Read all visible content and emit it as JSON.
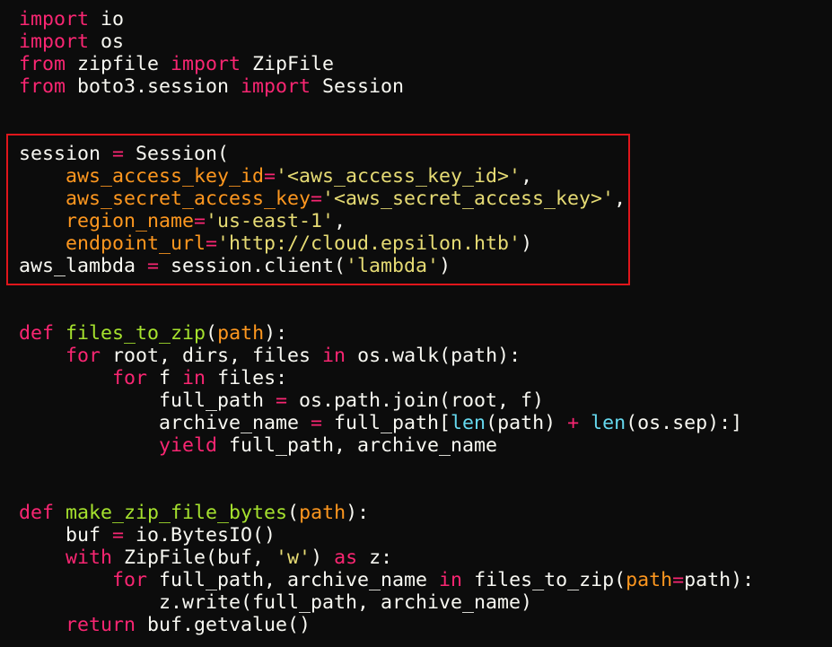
{
  "code_lines": [
    [
      {
        "t": "import",
        "c": "kw"
      },
      {
        "t": " io",
        "c": ""
      }
    ],
    [
      {
        "t": "import",
        "c": "kw"
      },
      {
        "t": " os",
        "c": ""
      }
    ],
    [
      {
        "t": "from",
        "c": "kw"
      },
      {
        "t": " zipfile ",
        "c": ""
      },
      {
        "t": "import",
        "c": "kw"
      },
      {
        "t": " ZipFile",
        "c": ""
      }
    ],
    [
      {
        "t": "from",
        "c": "kw"
      },
      {
        "t": " boto3.session ",
        "c": ""
      },
      {
        "t": "import",
        "c": "kw"
      },
      {
        "t": " Session",
        "c": ""
      }
    ],
    [],
    [],
    [
      {
        "t": "session ",
        "c": ""
      },
      {
        "t": "=",
        "c": "op"
      },
      {
        "t": " Session(",
        "c": ""
      }
    ],
    [
      {
        "t": "    ",
        "c": ""
      },
      {
        "t": "aws_access_key_id",
        "c": "prm"
      },
      {
        "t": "=",
        "c": "op"
      },
      {
        "t": "'<aws_access_key_id>'",
        "c": "str"
      },
      {
        "t": ",",
        "c": ""
      }
    ],
    [
      {
        "t": "    ",
        "c": ""
      },
      {
        "t": "aws_secret_access_key",
        "c": "prm"
      },
      {
        "t": "=",
        "c": "op"
      },
      {
        "t": "'<aws_secret_access_key>'",
        "c": "str"
      },
      {
        "t": ",",
        "c": ""
      }
    ],
    [
      {
        "t": "    ",
        "c": ""
      },
      {
        "t": "region_name",
        "c": "prm"
      },
      {
        "t": "=",
        "c": "op"
      },
      {
        "t": "'us-east-1'",
        "c": "str"
      },
      {
        "t": ",",
        "c": ""
      }
    ],
    [
      {
        "t": "    ",
        "c": ""
      },
      {
        "t": "endpoint_url",
        "c": "prm"
      },
      {
        "t": "=",
        "c": "op"
      },
      {
        "t": "'http://cloud.epsilon.htb'",
        "c": "str"
      },
      {
        "t": ")",
        "c": ""
      }
    ],
    [
      {
        "t": "aws_lambda ",
        "c": ""
      },
      {
        "t": "=",
        "c": "op"
      },
      {
        "t": " session.client(",
        "c": ""
      },
      {
        "t": "'lambda'",
        "c": "str"
      },
      {
        "t": ")",
        "c": ""
      }
    ],
    [],
    [],
    [
      {
        "t": "def",
        "c": "kw"
      },
      {
        "t": " ",
        "c": ""
      },
      {
        "t": "files_to_zip",
        "c": "fn"
      },
      {
        "t": "(",
        "c": ""
      },
      {
        "t": "path",
        "c": "prm"
      },
      {
        "t": "):",
        "c": ""
      }
    ],
    [
      {
        "t": "    ",
        "c": ""
      },
      {
        "t": "for",
        "c": "kw"
      },
      {
        "t": " root, dirs, files ",
        "c": ""
      },
      {
        "t": "in",
        "c": "kw"
      },
      {
        "t": " os.walk(path):",
        "c": ""
      }
    ],
    [
      {
        "t": "        ",
        "c": ""
      },
      {
        "t": "for",
        "c": "kw"
      },
      {
        "t": " f ",
        "c": ""
      },
      {
        "t": "in",
        "c": "kw"
      },
      {
        "t": " files:",
        "c": ""
      }
    ],
    [
      {
        "t": "            full_path ",
        "c": ""
      },
      {
        "t": "=",
        "c": "op"
      },
      {
        "t": " os.path.join(root, f)",
        "c": ""
      }
    ],
    [
      {
        "t": "            archive_name ",
        "c": ""
      },
      {
        "t": "=",
        "c": "op"
      },
      {
        "t": " full_path[",
        "c": ""
      },
      {
        "t": "len",
        "c": "bi"
      },
      {
        "t": "(path) ",
        "c": ""
      },
      {
        "t": "+",
        "c": "op"
      },
      {
        "t": " ",
        "c": ""
      },
      {
        "t": "len",
        "c": "bi"
      },
      {
        "t": "(os.sep):]",
        "c": ""
      }
    ],
    [
      {
        "t": "            ",
        "c": ""
      },
      {
        "t": "yield",
        "c": "kw"
      },
      {
        "t": " full_path, archive_name",
        "c": ""
      }
    ],
    [],
    [],
    [
      {
        "t": "def",
        "c": "kw"
      },
      {
        "t": " ",
        "c": ""
      },
      {
        "t": "make_zip_file_bytes",
        "c": "fn"
      },
      {
        "t": "(",
        "c": ""
      },
      {
        "t": "path",
        "c": "prm"
      },
      {
        "t": "):",
        "c": ""
      }
    ],
    [
      {
        "t": "    buf ",
        "c": ""
      },
      {
        "t": "=",
        "c": "op"
      },
      {
        "t": " io.BytesIO()",
        "c": ""
      }
    ],
    [
      {
        "t": "    ",
        "c": ""
      },
      {
        "t": "with",
        "c": "kw"
      },
      {
        "t": " ZipFile(buf, ",
        "c": ""
      },
      {
        "t": "'w'",
        "c": "str"
      },
      {
        "t": ") ",
        "c": ""
      },
      {
        "t": "as",
        "c": "kw"
      },
      {
        "t": " z:",
        "c": ""
      }
    ],
    [
      {
        "t": "        ",
        "c": ""
      },
      {
        "t": "for",
        "c": "kw"
      },
      {
        "t": " full_path, archive_name ",
        "c": ""
      },
      {
        "t": "in",
        "c": "kw"
      },
      {
        "t": " files_to_zip(",
        "c": ""
      },
      {
        "t": "path",
        "c": "prm"
      },
      {
        "t": "=",
        "c": "op"
      },
      {
        "t": "path):",
        "c": ""
      }
    ],
    [
      {
        "t": "            z.write(full_path, archive_name)",
        "c": ""
      }
    ],
    [
      {
        "t": "    ",
        "c": ""
      },
      {
        "t": "return",
        "c": "kw"
      },
      {
        "t": " buf.getvalue()",
        "c": ""
      }
    ]
  ],
  "colors": {
    "background": "#0c0c0c",
    "text": "#f8f8f2",
    "keyword": "#f92672",
    "function": "#a6e22e",
    "parameter": "#fd971f",
    "string": "#e6db74",
    "builtin": "#66d9ef",
    "highlight_border": "#e0161b"
  }
}
